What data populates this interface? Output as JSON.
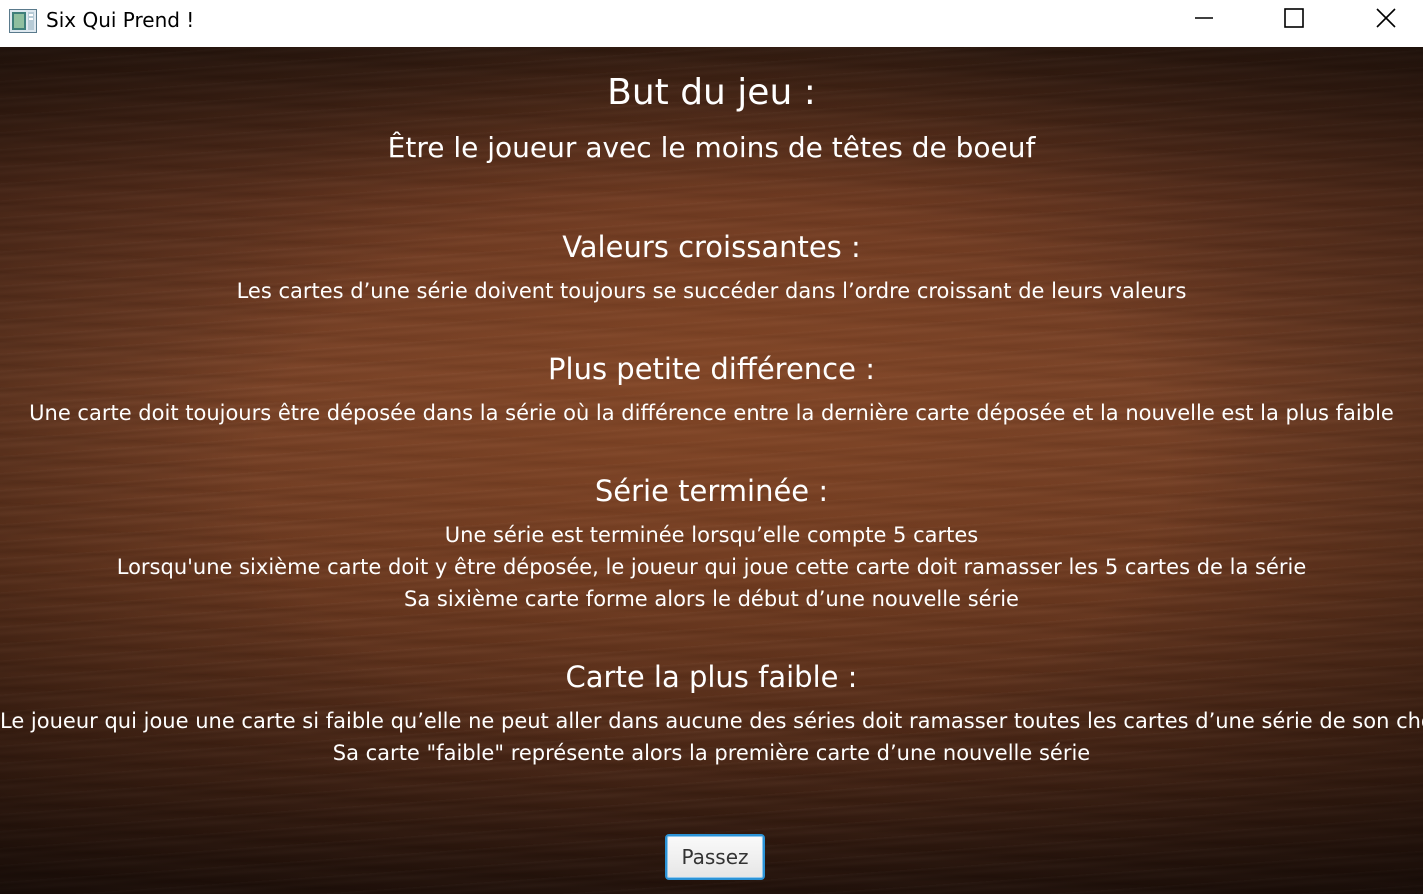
{
  "window": {
    "title": "Six Qui Prend !",
    "icons": {
      "app": "app-icon",
      "minimize": "minimize-icon",
      "maximize": "maximize-icon",
      "close": "close-icon"
    }
  },
  "rules": {
    "goal": {
      "heading": "But du jeu :",
      "text": "Être le joueur avec le moins de têtes de boeuf"
    },
    "increasing_values": {
      "heading": "Valeurs croissantes :",
      "text": "Les cartes d’une série doivent toujours se succéder dans l’ordre croissant de leurs valeurs"
    },
    "smallest_difference": {
      "heading": "Plus petite différence :",
      "text": "Une carte doit toujours être déposée dans la série où la différence entre la dernière carte déposée et la nouvelle est la plus faible"
    },
    "finished_series": {
      "heading": "Série terminée :",
      "lines": [
        "Une série est terminée lorsqu’elle compte 5 cartes",
        "Lorsqu'une sixième carte doit y être déposée, le joueur qui joue cette carte doit ramasser les 5 cartes de la série",
        "Sa sixième carte forme alors le début d’une nouvelle série"
      ]
    },
    "lowest_card": {
      "heading": "Carte la plus faible :",
      "lines": [
        "Le joueur qui joue une carte si faible qu’elle ne peut aller dans aucune des séries doit ramasser toutes les cartes d’une série de son choix",
        "Sa carte \"faible\" représente alors la première carte d’une nouvelle série"
      ]
    }
  },
  "actions": {
    "next_label": "Passez"
  },
  "colors": {
    "text": "#ffffff",
    "wood_dark": "#3a1f12",
    "wood_mid": "#7a4226",
    "button_focus": "#2b93d6"
  }
}
